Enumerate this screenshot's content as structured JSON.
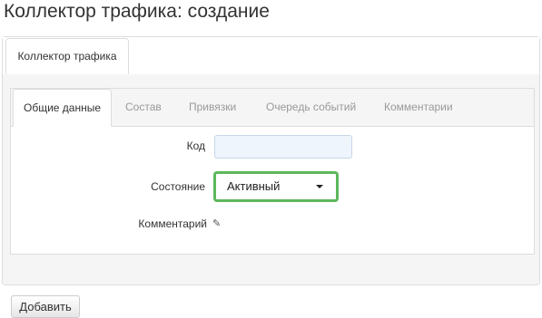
{
  "page": {
    "title": "Коллектор трафика: создание"
  },
  "outer_tabs": [
    {
      "label": "Коллектор трафика",
      "active": true
    }
  ],
  "inner_tabs": [
    {
      "label": "Общие данные",
      "active": true
    },
    {
      "label": "Состав",
      "active": false
    },
    {
      "label": "Привязки",
      "active": false
    },
    {
      "label": "Очередь событий",
      "active": false
    },
    {
      "label": "Комментарии",
      "active": false
    }
  ],
  "form": {
    "code_label": "Код",
    "code_value": "",
    "status_label": "Состояние",
    "status_value": "Активный",
    "comment_label": "Комментарий",
    "comment_icon": "pencil-icon"
  },
  "actions": {
    "add_label": "Добавить"
  },
  "colors": {
    "focus_border": "#5cb85c",
    "input_bg": "#eef5fc",
    "tab_inactive_text": "#999999"
  }
}
